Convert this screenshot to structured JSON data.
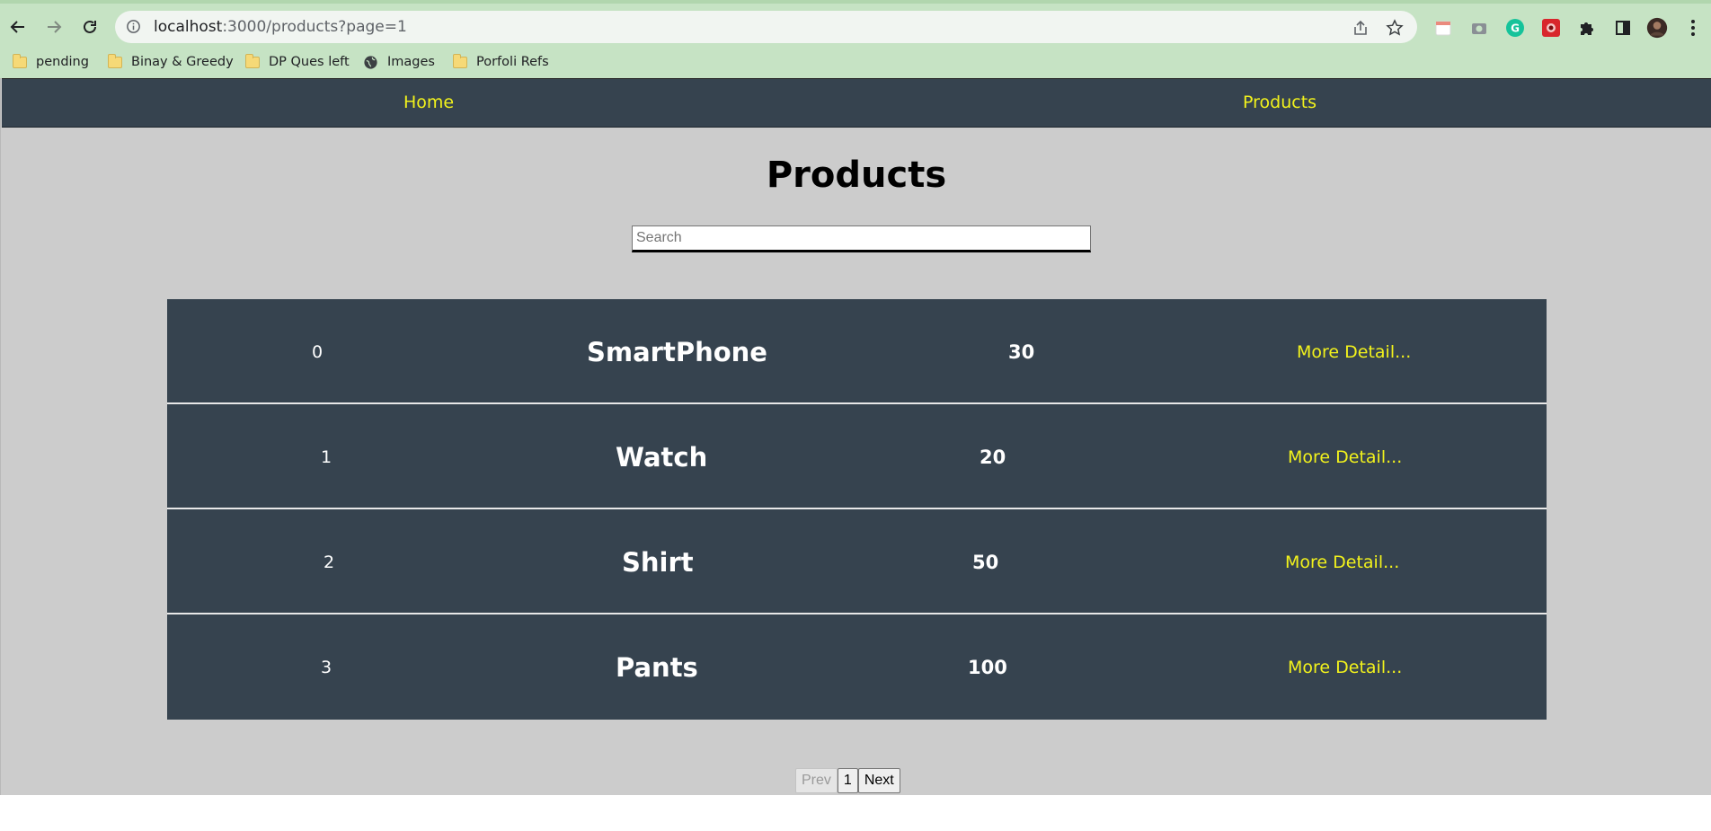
{
  "browser": {
    "url_host": "localhost",
    "url_rest": ":3000/products?page=1",
    "bookmarks": [
      {
        "label": "pending",
        "icon": "folder-icon"
      },
      {
        "label": "Binay & Greedy",
        "icon": "folder-icon"
      },
      {
        "label": "DP Ques left",
        "icon": "folder-icon"
      },
      {
        "label": "Images",
        "icon": "globe-icon"
      },
      {
        "label": "Porfoli Refs",
        "icon": "folder-icon"
      }
    ]
  },
  "nav": {
    "home": "Home",
    "products": "Products"
  },
  "page": {
    "title": "Products",
    "search_placeholder": "Search"
  },
  "products": [
    {
      "index": "0",
      "name": "SmartPhone",
      "price": "30",
      "more": "More Detail..."
    },
    {
      "index": "1",
      "name": "Watch",
      "price": "20",
      "more": "More Detail..."
    },
    {
      "index": "2",
      "name": "Shirt",
      "price": "50",
      "more": "More Detail..."
    },
    {
      "index": "3",
      "name": "Pants",
      "price": "100",
      "more": "More Detail..."
    }
  ],
  "pagination": {
    "prev": "Prev",
    "current": "1",
    "next": "Next"
  },
  "colors": {
    "accent": "#f2f21c",
    "row_bg": "#36434f",
    "page_bg": "#cccccc"
  }
}
